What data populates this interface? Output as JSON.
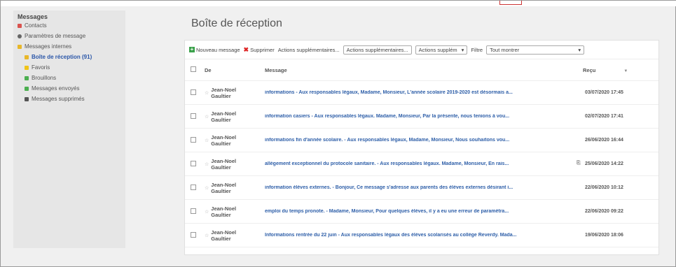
{
  "sidebar": {
    "header": "Messages",
    "items": [
      {
        "label": "Contacts",
        "icon": "phone-icon",
        "color": "#d9534f"
      },
      {
        "label": "Paramètres de message",
        "icon": "gear-icon",
        "color": "#666666"
      },
      {
        "label": "Messages internes",
        "icon": "folder-icon",
        "color": "#e8b72a"
      },
      {
        "label": "Boîte de réception (91)",
        "icon": "inbox-folder-icon",
        "color": "#e8b72a"
      },
      {
        "label": "Favoris",
        "icon": "star-icon",
        "color": "#f0c419"
      },
      {
        "label": "Brouillons",
        "icon": "pencil-icon",
        "color": "#4caf50"
      },
      {
        "label": "Messages envoyés",
        "icon": "send-icon",
        "color": "#4caf50"
      },
      {
        "label": "Messages supprimés",
        "icon": "trash-icon",
        "color": "#555555"
      }
    ]
  },
  "page_title": "Boîte de réception",
  "toolbar": {
    "new_label": "Nouveau message",
    "delete_label": "Supprimer",
    "more_actions_label": "Actions supplémentaires...",
    "more_actions_select": "Actions supplém",
    "filter_label": "Filtre",
    "filter_value": "Tout montrer"
  },
  "table": {
    "headers": {
      "from": "De",
      "message": "Message",
      "received": "Reçu"
    },
    "rows": [
      {
        "from_first": "Jean-Noel",
        "from_last": "Gaultier",
        "message": "informations - Aux responsables légaux,   Madame, Monsieur, L'année scolaire 2019-2020 est désormais a...",
        "date": "03/07/2020 17:45",
        "attachment": ""
      },
      {
        "from_first": "Jean-Noel",
        "from_last": "Gaultier",
        "message": "information casiers - Aux responsables légaux.   Madame, Monsieur,   Par la présente, nous tenions à vou...",
        "date": "02/07/2020 17:41",
        "attachment": ""
      },
      {
        "from_first": "Jean-Noel",
        "from_last": "Gaultier",
        "message": "informations fin d'année scolaire. - Aux responsables légaux,  Madame, Monsieur,   Nous souhaitons vou...",
        "date": "26/06/2020 16:44",
        "attachment": ""
      },
      {
        "from_first": "Jean-Noel",
        "from_last": "Gaultier",
        "message": "allègement exceptionnel du protocole sanitaire. - Aux responsables légaux.  Madame, Monsieur,   En rais...",
        "date": "25/06/2020 14:22",
        "attachment": "⎘"
      },
      {
        "from_first": "Jean-Noel",
        "from_last": "Gaultier",
        "message": "information élèves externes. - Bonjour,   Ce message s'adresse aux parents des élèves externes désirant i...",
        "date": "22/06/2020 10:12",
        "attachment": ""
      },
      {
        "from_first": "Jean-Noel",
        "from_last": "Gaultier",
        "message": "emploi du temps pronote. - Madame, Monsieur,   Pour quelques élèves, il y a eu une erreur de paramétra...",
        "date": "22/06/2020 09:22",
        "attachment": ""
      },
      {
        "from_first": "Jean-Noel",
        "from_last": "Gaultier",
        "message": "Informations rentrée du 22 juin - Aux responsables légaux des élèves scolarisés au collège Reverdy. Mada...",
        "date": "19/06/2020 18:06",
        "attachment": ""
      }
    ]
  }
}
